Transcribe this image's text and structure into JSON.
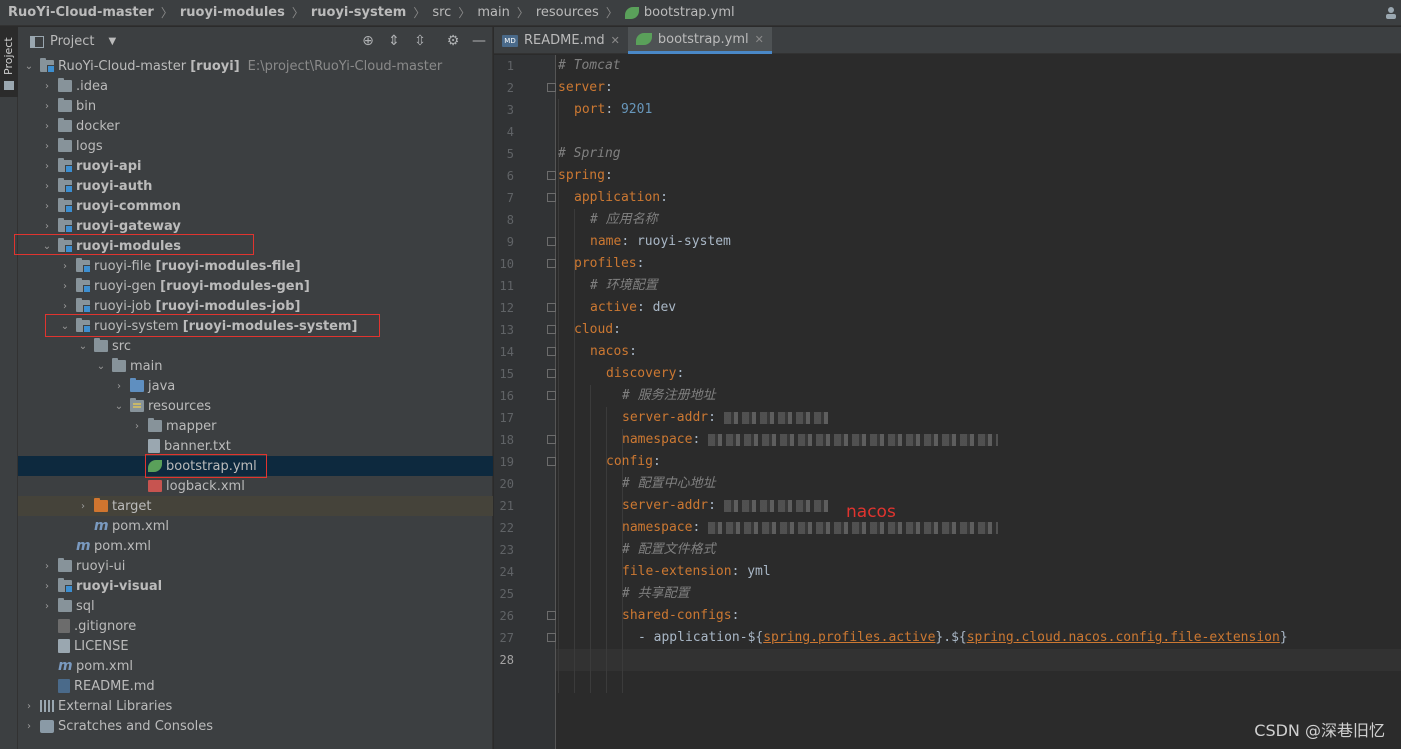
{
  "breadcrumb": [
    "RuoYi-Cloud-master",
    "ruoyi-modules",
    "ruoyi-system",
    "src",
    "main",
    "resources",
    "bootstrap.yml"
  ],
  "project_panel": {
    "title": "Project",
    "root": {
      "name": "RuoYi-Cloud-master",
      "module": "[ruoyi]",
      "path": "E:\\project\\RuoYi-Cloud-master"
    },
    "items": [
      {
        "label": ".idea"
      },
      {
        "label": "bin"
      },
      {
        "label": "docker"
      },
      {
        "label": "logs"
      },
      {
        "label": "ruoyi-api"
      },
      {
        "label": "ruoyi-auth"
      },
      {
        "label": "ruoyi-common"
      },
      {
        "label": "ruoyi-gateway"
      },
      {
        "label": "ruoyi-modules"
      },
      {
        "label": "ruoyi-file",
        "extra": "[ruoyi-modules-file]"
      },
      {
        "label": "ruoyi-gen",
        "extra": "[ruoyi-modules-gen]"
      },
      {
        "label": "ruoyi-job",
        "extra": "[ruoyi-modules-job]"
      },
      {
        "label": "ruoyi-system",
        "extra": "[ruoyi-modules-system]"
      },
      {
        "label": "src"
      },
      {
        "label": "main"
      },
      {
        "label": "java"
      },
      {
        "label": "resources"
      },
      {
        "label": "mapper"
      },
      {
        "label": "banner.txt"
      },
      {
        "label": "bootstrap.yml"
      },
      {
        "label": "logback.xml"
      },
      {
        "label": "target"
      },
      {
        "label": "pom.xml"
      },
      {
        "label": "pom.xml"
      },
      {
        "label": "ruoyi-ui"
      },
      {
        "label": "ruoyi-visual"
      },
      {
        "label": "sql"
      },
      {
        "label": ".gitignore"
      },
      {
        "label": "LICENSE"
      },
      {
        "label": "pom.xml"
      },
      {
        "label": "README.md"
      },
      {
        "label": "External Libraries"
      },
      {
        "label": "Scratches and Consoles"
      }
    ]
  },
  "tool_strip": {
    "label": "Project"
  },
  "editor": {
    "tabs": [
      {
        "label": "README.md",
        "icon_text": "MD"
      },
      {
        "label": "bootstrap.yml"
      }
    ],
    "lines": [
      {
        "n": "1",
        "comment": "# Tomcat"
      },
      {
        "n": "2",
        "key": "server",
        "sep": ":"
      },
      {
        "n": "3",
        "key": "port",
        "sep": ": ",
        "num": "9201"
      },
      {
        "n": "4"
      },
      {
        "n": "5",
        "comment": "# Spring"
      },
      {
        "n": "6",
        "key": "spring",
        "sep": ":"
      },
      {
        "n": "7",
        "key": "application",
        "sep": ":"
      },
      {
        "n": "8",
        "comment": "# 应用名称"
      },
      {
        "n": "9",
        "key": "name",
        "sep": ": ",
        "value": "ruoyi-system"
      },
      {
        "n": "10",
        "key": "profiles",
        "sep": ":"
      },
      {
        "n": "11",
        "comment": "# 环境配置"
      },
      {
        "n": "12",
        "key": "active",
        "sep": ": ",
        "value": "dev"
      },
      {
        "n": "13",
        "key": "cloud",
        "sep": ":"
      },
      {
        "n": "14",
        "key": "nacos",
        "sep": ":"
      },
      {
        "n": "15",
        "key": "discovery",
        "sep": ":"
      },
      {
        "n": "16",
        "comment": "# 服务注册地址"
      },
      {
        "n": "17",
        "key": "server-addr",
        "sep": ": "
      },
      {
        "n": "18",
        "key": "namespace",
        "sep": ": "
      },
      {
        "n": "19",
        "key": "config",
        "sep": ":"
      },
      {
        "n": "20",
        "comment": "# 配置中心地址"
      },
      {
        "n": "21",
        "key": "server-addr",
        "sep": ": "
      },
      {
        "n": "22",
        "key": "namespace",
        "sep": ": "
      },
      {
        "n": "23",
        "comment": "# 配置文件格式"
      },
      {
        "n": "24",
        "key": "file-extension",
        "sep": ": ",
        "value": "yml"
      },
      {
        "n": "25",
        "comment": "# 共享配置"
      },
      {
        "n": "26",
        "key": "shared-configs",
        "sep": ":"
      },
      {
        "n": "27",
        "dash": "- ",
        "value": "application-${",
        "link1": "spring.profiles.active",
        "mid": "}.${",
        "link2": "spring.cloud.nacos.config.file-extension",
        "end": "}"
      },
      {
        "n": "28"
      }
    ]
  },
  "annotation": "nacos",
  "watermark": "CSDN @深巷旧忆",
  "colors": {
    "highlight_box": "#e0342f",
    "keyword": "#cc7832",
    "comment": "#808080",
    "number": "#6897bb",
    "selected_row": "#0d293e"
  }
}
